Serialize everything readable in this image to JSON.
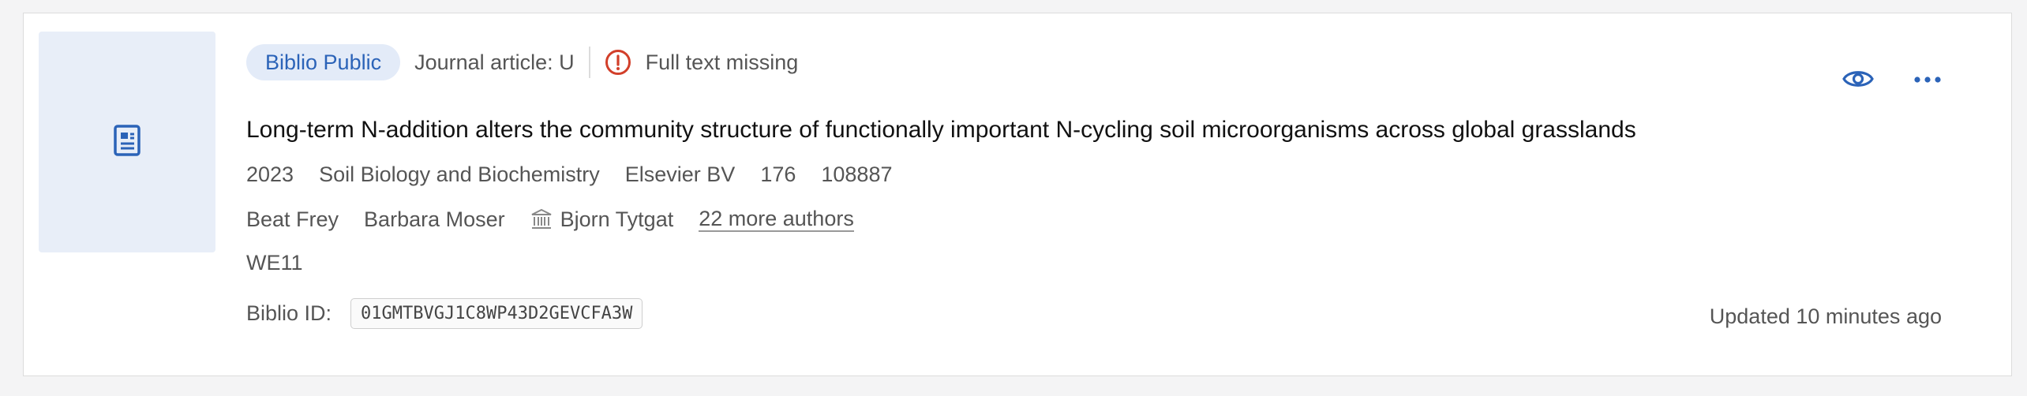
{
  "record": {
    "badge": "Biblio Public",
    "type": "Journal article: U",
    "warning": "Full text missing",
    "title": "Long-term N-addition alters the community structure of functionally important N-cycling soil microorganisms across global grasslands",
    "year": "2023",
    "journal": "Soil Biology and Biochemistry",
    "publisher": "Elsevier BV",
    "volume": "176",
    "pages": "108887",
    "authors": [
      "Beat Frey",
      "Barbara Moser",
      "Bjorn Tytgat"
    ],
    "more_authors": "22 more authors",
    "code": "WE11",
    "biblio_id_label": "Biblio ID:",
    "biblio_id": "01GMTBVGJ1C8WP43D2GEVCFA3W",
    "updated": "Updated 10 minutes ago"
  },
  "colors": {
    "accent": "#2b63b8",
    "warning": "#d23f2a",
    "thumb_bg": "#e8eef8"
  },
  "icons": {
    "thumbnail": "document-icon",
    "warning": "exclamation-circle-icon",
    "institution": "institution-icon",
    "view": "eye-icon",
    "menu": "more-horizontal-icon"
  }
}
